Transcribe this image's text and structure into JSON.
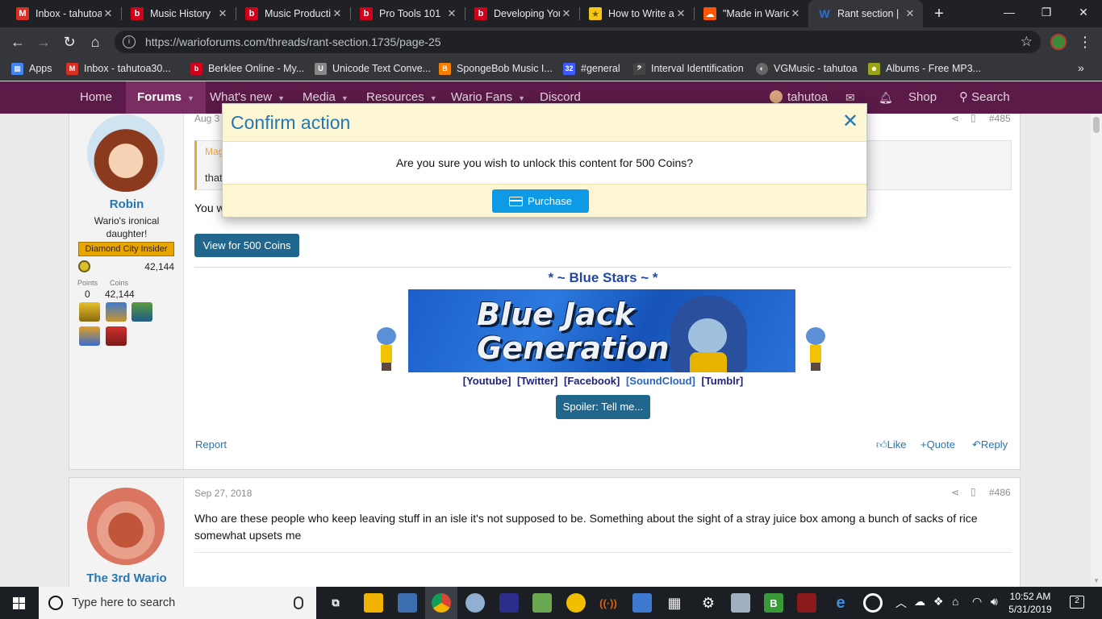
{
  "browser": {
    "tabs": [
      {
        "title": "Inbox - tahutoa",
        "fav_color": "#d93025",
        "fav_glyph": "M"
      },
      {
        "title": "Music History",
        "fav_color": "#d0021b",
        "fav_glyph": "b"
      },
      {
        "title": "Music Production",
        "fav_color": "#d0021b",
        "fav_glyph": "b"
      },
      {
        "title": "Pro Tools 101",
        "fav_color": "#d0021b",
        "fav_glyph": "b"
      },
      {
        "title": "Developing Your",
        "fav_color": "#d0021b",
        "fav_glyph": "b"
      },
      {
        "title": "How to Write a",
        "fav_color": "#f5c518",
        "fav_glyph": "★"
      },
      {
        "title": "\"Made in Wario\"",
        "fav_color": "#ff5500",
        "fav_glyph": "☁"
      },
      {
        "title": "Rant section |",
        "fav_color": "#2b6fd6",
        "fav_glyph": "W"
      }
    ],
    "new_tab_glyph": "+",
    "window": {
      "minimize": "—",
      "maximize": "❐",
      "close": "✕"
    },
    "url": "https://warioforums.com/threads/rant-section.1735/page-25",
    "bookmarks": [
      {
        "label": "Apps",
        "color": "#4285f4",
        "glyph": "▦"
      },
      {
        "label": "Inbox - tahutoa30...",
        "color": "#d93025",
        "glyph": "M"
      },
      {
        "label": "Berklee Online - My...",
        "color": "#d0021b",
        "glyph": "b"
      },
      {
        "label": "Unicode Text Conve...",
        "color": "#888888",
        "glyph": "U"
      },
      {
        "label": "SpongeBob Music I...",
        "color": "#f57d00",
        "glyph": "B"
      },
      {
        "label": "#general",
        "color": "#3d5afe",
        "glyph": "32"
      },
      {
        "label": "Interval Identification",
        "color": "#444444",
        "glyph": "𝄢"
      },
      {
        "label": "VGMusic - tahutoa",
        "color": "#666666",
        "glyph": "◐"
      },
      {
        "label": "Albums - Free MP3...",
        "color": "#9aa31c",
        "glyph": "☻"
      }
    ],
    "bookmarks_more": "»"
  },
  "site_nav": {
    "items": [
      "Home",
      "Forums",
      "What's new",
      "Media",
      "Resources",
      "Wario Fans",
      "Discord"
    ],
    "user": "tahutoa",
    "shop": "Shop",
    "search": "Search"
  },
  "post1": {
    "date": "Aug 3",
    "number": "#485",
    "user": {
      "name": "Robin",
      "title": "Wario's ironical daughter!",
      "banner": "Diamond City Insider",
      "coins_total": "42,144",
      "points_label": "Points",
      "coins_label": "Coins",
      "points": "0",
      "coins": "42,144"
    },
    "quote_author": "Mag",
    "quote_text": "that",
    "body": "You wanna know the best way to make money?",
    "unlock_button": "View for 500 Coins",
    "signature": {
      "title": "* ~ Blue Stars ~ *",
      "banner_text_1": "Blue  Jack",
      "banner_text_2": "Generation",
      "links": [
        "[Youtube]",
        "[Twitter]",
        "[Facebook]",
        "[SoundCloud]",
        "[Tumblr]"
      ],
      "spoiler_button": "Spoiler: Tell me..."
    },
    "report": "Report",
    "actions": {
      "like": "Like",
      "quote": "Quote",
      "reply": "Reply"
    }
  },
  "post2": {
    "date": "Sep 27, 2018",
    "number": "#486",
    "user": {
      "name": "The 3rd Wario"
    },
    "body": "Who are these people who keep leaving stuff in an isle it's not supposed to be. Something about the sight of a stray juice box among a bunch of sacks of rice somewhat upsets me"
  },
  "modal": {
    "title": "Confirm action",
    "close": "✕",
    "message": "Are you sure you wish to unlock this content for 500 Coins?",
    "button": "Purchase"
  },
  "taskbar": {
    "search_placeholder": "Type here to search",
    "time": "10:52 AM",
    "date": "5/31/2019",
    "notifications": "2"
  }
}
